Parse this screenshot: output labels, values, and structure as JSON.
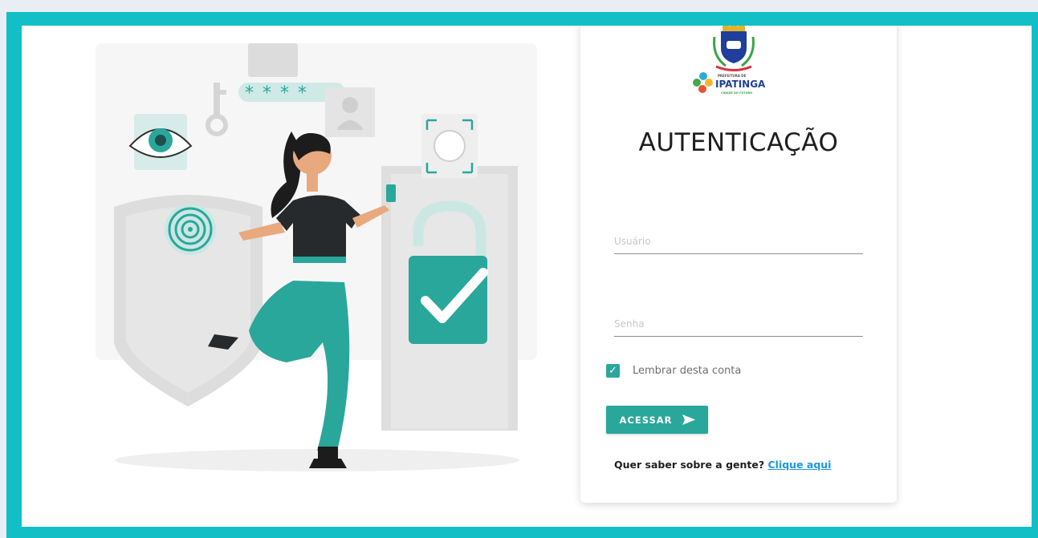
{
  "logo": {
    "line_top": "PREFEITURA DE",
    "name": "IPATINGA",
    "tagline": "CIDADE DO FUTURO"
  },
  "title": "AUTENTICAÇÃO",
  "form": {
    "username_placeholder": "Usuário",
    "password_placeholder": "Senha",
    "remember_label": "Lembrar desta conta",
    "remember_checked": true,
    "submit_label": "ACESSAR"
  },
  "about": {
    "text": "Quer saber sobre a gente?",
    "link": "Clique aqui"
  },
  "colors": {
    "frame": "#12bfc6",
    "accent": "#2aa79b",
    "link": "#1c97e0"
  },
  "icons": [
    "check-icon",
    "send-arrow-icon",
    "ipatinga-coat-of-arms-icon"
  ]
}
